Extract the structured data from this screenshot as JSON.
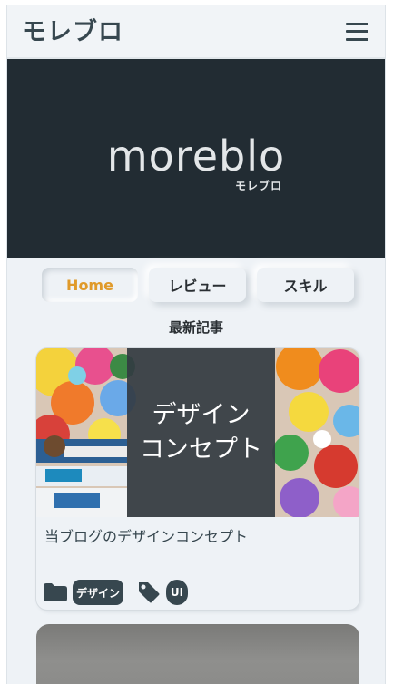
{
  "header": {
    "logo": "モレブロ",
    "menu_icon": "hamburger-menu-icon"
  },
  "hero": {
    "logo_text": "moreblo",
    "sub_text": "モレブロ"
  },
  "nav": {
    "items": [
      {
        "label": "Home",
        "active": true
      },
      {
        "label": "レビュー",
        "active": false
      },
      {
        "label": "スキル",
        "active": false
      }
    ]
  },
  "section": {
    "title": "最新記事"
  },
  "posts": [
    {
      "thumb_line1": "デザイン",
      "thumb_line2": "コンセプト",
      "title": "当ブログのデザインコンセプト",
      "category": "デザイン",
      "tag": "UI",
      "category_icon": "folder-icon",
      "tag_icon": "tag-icon"
    }
  ],
  "colors": {
    "accent": "#e09a2a",
    "dark": "#37474f",
    "hero_bg": "#222c33",
    "page_bg": "#eef2f6"
  }
}
